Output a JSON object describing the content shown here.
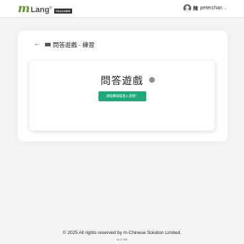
{
  "header": {
    "logo_m": "m",
    "logo_text": "Lang",
    "logo_reg": "®",
    "logo_badge": "TEACHER",
    "user_cjk": "陳",
    "user_name": "peterchan",
    "user_menu_icon": "chevron-down-icon"
  },
  "page": {
    "back_icon": "arrow-left-icon",
    "mode_badge_icon": "badge-icon",
    "title": "問答遊戲 - 練習"
  },
  "game": {
    "title": "問答遊戲",
    "status_color": "#8f8f8f",
    "start_button": "請點擊按鈕進入遊戲！"
  },
  "footer": {
    "copyright": "© 2025 All rights reserved by m-Chinese Solution Limited.",
    "version": "v1.2.190"
  },
  "colors": {
    "brand_green": "#5a9a23",
    "button_green": "#1fa87c",
    "background": "#f4f5f4"
  }
}
